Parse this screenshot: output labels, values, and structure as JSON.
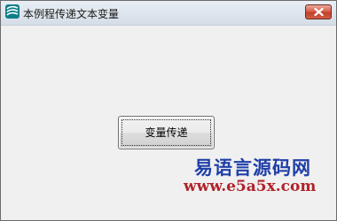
{
  "window": {
    "title": "本例程传递文本变量",
    "icons": {
      "app": "app-icon",
      "close": "close-icon"
    }
  },
  "main": {
    "button_label": "变量传递"
  },
  "watermark": {
    "title": "易语言源码网",
    "url": "www.e5a5x.com"
  },
  "colors": {
    "titlebar": "#dfe6ee",
    "client_bg": "#f0f0f0",
    "close_button": "#c94a35",
    "watermark_title": "#1f3fa8",
    "watermark_url": "#b1232a"
  }
}
